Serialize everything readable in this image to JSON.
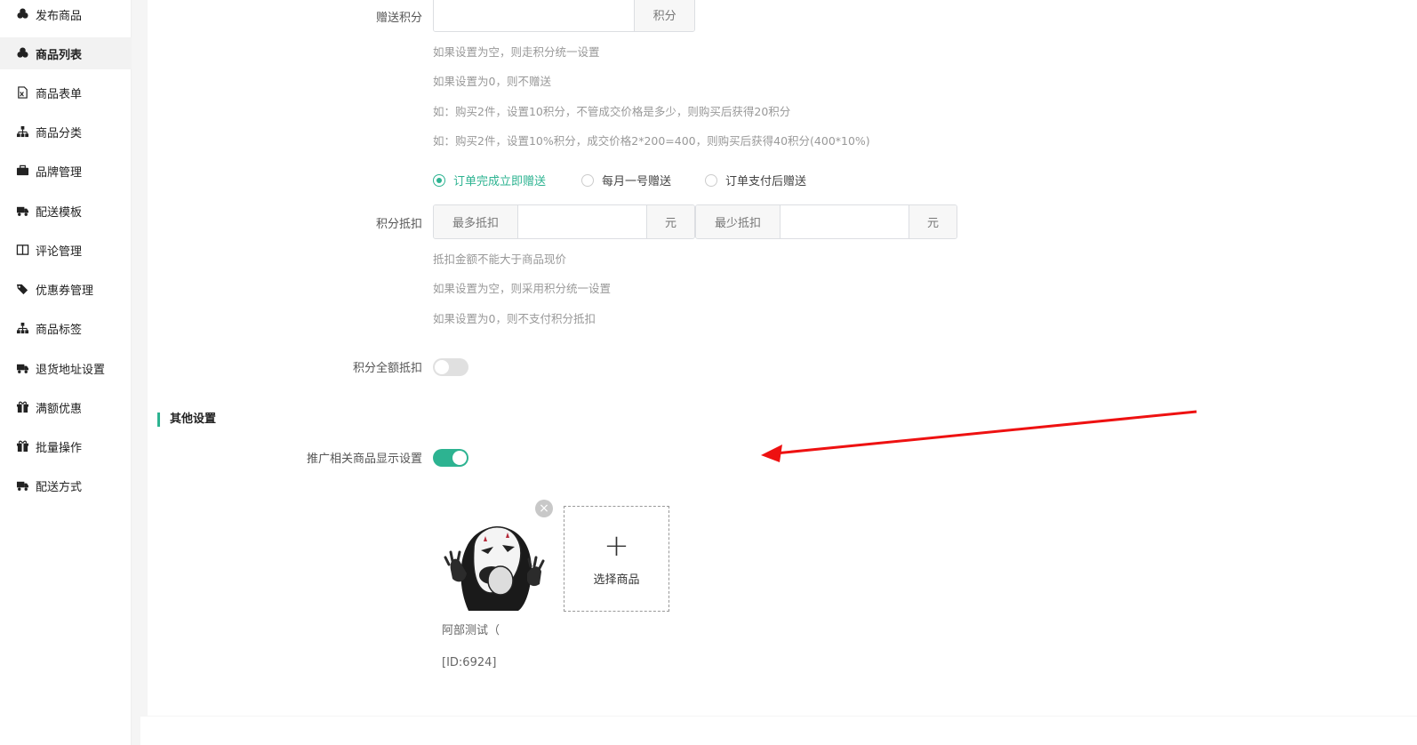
{
  "sidebar": {
    "items": [
      {
        "label": "发布商品",
        "icon": "cubes-icon"
      },
      {
        "label": "商品列表",
        "icon": "cubes-icon",
        "active": true
      },
      {
        "label": "商品表单",
        "icon": "file-excel-icon"
      },
      {
        "label": "商品分类",
        "icon": "sitemap-icon"
      },
      {
        "label": "品牌管理",
        "icon": "briefcase-icon"
      },
      {
        "label": "配送模板",
        "icon": "truck-icon"
      },
      {
        "label": "评论管理",
        "icon": "columns-icon"
      },
      {
        "label": "优惠券管理",
        "icon": "tags-icon"
      },
      {
        "label": "商品标签",
        "icon": "sitemap-icon"
      },
      {
        "label": "退货地址设置",
        "icon": "truck-icon"
      },
      {
        "label": "满额优惠",
        "icon": "gift-icon"
      },
      {
        "label": "批量操作",
        "icon": "gift-icon"
      },
      {
        "label": "配送方式",
        "icon": "truck-icon"
      }
    ]
  },
  "points_gift": {
    "label": "赠送积分",
    "value": "",
    "suffix": "积分",
    "hints": [
      "如果设置为空，则走积分统一设置",
      "如果设置为0，则不赠送",
      "如：购买2件，设置10积分，不管成交价格是多少，则购买后获得20积分",
      "如：购买2件，设置10%积分，成交价格2*200=400，则购买后获得40积分(400*10%)"
    ],
    "timing_options": [
      "订单完成立即赠送",
      "每月一号赠送",
      "订单支付后赠送"
    ],
    "timing_selected": "订单完成立即赠送"
  },
  "points_deduct": {
    "label": "积分抵扣",
    "max_prefix": "最多抵扣",
    "max_value": "",
    "max_suffix": "元",
    "min_prefix": "最少抵扣",
    "min_value": "",
    "min_suffix": "元",
    "hints": [
      "抵扣金额不能大于商品现价",
      "如果设置为空，则采用积分统一设置",
      "如果设置为0，则不支付积分抵扣"
    ]
  },
  "full_deduct": {
    "label": "积分全额抵扣",
    "enabled": false
  },
  "other_settings": {
    "title": "其他设置",
    "promo_label": "推广相关商品显示设置",
    "promo_enabled": true,
    "product_name": "阿部测试（",
    "product_id": "[ID:6924]",
    "close_glyph": "×",
    "select_plus": "+",
    "select_label": "选择商品"
  },
  "colors": {
    "accent": "#2db391",
    "arrow": "#ee1111"
  }
}
